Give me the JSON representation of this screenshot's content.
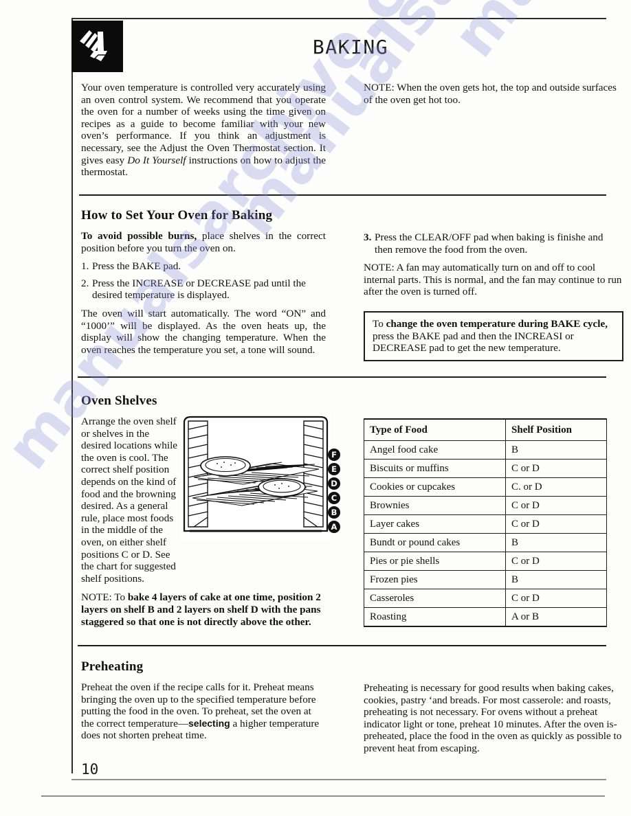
{
  "document": {
    "title": "BAKING",
    "page_number": "10",
    "header_icon": "hand-pressing-button-icon",
    "watermark_text": "manualsarchive.com"
  },
  "intro": {
    "left_paragraph": "Your oven temperature is controlled very accurately using an oven control system. We recommend that you operate the oven for a number of weeks using the time given on recipes as a guide to become familiar with your new oven’s performance. If you think an adjustment is necessary, see the Adjust the Oven Thermostat section. It gives easy ",
    "left_italic": "Do It Yourself",
    "left_paragraph_tail": " instructions on how to adjust the thermostat.",
    "right_note": "NOTE: When the oven gets hot, the top and outside surfaces of the oven get hot too."
  },
  "how_to_set": {
    "heading": "How to Set Your Oven for Baking",
    "warning_bold": "To avoid possible burns,",
    "warning_rest": " place shelves in the correct position before you turn the oven on.",
    "steps": [
      {
        "num": "1.",
        "text": "Press the BAKE pad."
      },
      {
        "num": "2.",
        "text": "Press the INCREASE or DECREASE pad until the desired temperature is displayed."
      },
      {
        "num": "3.",
        "text": "Press the CLEAR/OFF pad when baking is finishe and then remove the food from the oven."
      }
    ],
    "auto_start_paragraph": "The oven will start automatically. The word “ON” and “1000’” will be displayed. As the oven heats up, the display will show the changing temperature. When the oven reaches the temperature you set, a tone will sound.",
    "fan_note": "NOTE: A fan may automatically turn on and off to cool internal parts. This is normal, and the fan may continue to run after the oven is turned off.",
    "callout": {
      "lead": "To ",
      "bold1": "change the oven temperature during BAKE cycle,",
      "rest": " press the BAKE pad and then the INCREASI or DECREASE pad to get the new temperature."
    }
  },
  "oven_shelves": {
    "heading": "Oven Shelves",
    "paragraph": "Arrange the oven shelf or shelves in the desired locations while the oven is cool. The correct shelf position depends on the kind of food and the browning desired. As a general rule, place most foods in the middle of the oven, on either shelf positions C or D. See the chart for suggested shelf positions.",
    "note_prefix": "NOTE: To ",
    "note_bold": "bake 4 layers of cake at one time, position 2 layers on shelf B and 2 layers on shelf D with the pans staggered so that one is not directly above the other.",
    "illustration": {
      "name": "oven-cavity-shelves-illustration",
      "shelf_labels": [
        "F",
        "E",
        "D",
        "C",
        "B",
        "A"
      ],
      "items": [
        "pie-on-upper-rack",
        "pie-on-lower-rack"
      ]
    },
    "table": {
      "headers": [
        "Type of Food",
        "Shelf Position"
      ],
      "rows": [
        [
          "Angel food cake",
          "B"
        ],
        [
          "Biscuits or muffins",
          "C or D"
        ],
        [
          "Cookies or cupcakes",
          "C. or D"
        ],
        [
          "Brownies",
          "C or D"
        ],
        [
          "Layer cakes",
          "C or  D"
        ],
        [
          "Bundt   or   pound   cakes",
          "B"
        ],
        [
          "Pies or pie shells",
          "C or D"
        ],
        [
          "Frozen pies",
          "B"
        ],
        [
          "Casseroles",
          "C or D"
        ],
        [
          "Roasting",
          "A or B"
        ]
      ]
    }
  },
  "preheating": {
    "heading": "Preheating",
    "left_part1": "Preheat the oven if the recipe calls for it. Preheat means bringing the oven up to the specified temperature before putting the food in the oven. To preheat, set the oven at the correct temperature—",
    "left_bold": "selecting",
    "left_part2": " a higher temperature does not shorten preheat time.",
    "right_paragraph": "Preheating is necessary for good results when baking cakes, cookies, pastry ‘and breads. For most casserole: and roasts, preheating is not necessary. For ovens without a preheat indicator light or tone, preheat 10 minutes. After the oven is-preheated, place the food in the oven as quickly as possible to prevent heat from escaping."
  }
}
